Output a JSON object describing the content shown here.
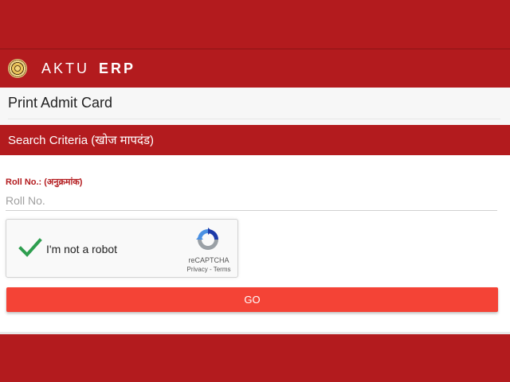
{
  "brand": {
    "part1": "AKTU",
    "part2": "ERP"
  },
  "page": {
    "title": "Print Admit Card"
  },
  "section": {
    "title": "Search Criteria (खोज मापदंड)"
  },
  "form": {
    "roll_label": "Roll No.: (अनुक्रमांक)",
    "roll_placeholder": "Roll No.",
    "roll_value": ""
  },
  "captcha": {
    "checked": true,
    "label": "I'm not a robot",
    "brand": "reCAPTCHA",
    "privacy": "Privacy",
    "separator": " - ",
    "terms": "Terms",
    "icon": "recaptcha-logo-icon"
  },
  "actions": {
    "go_label": "GO"
  },
  "colors": {
    "primary": "#b31b1e",
    "button": "#f44336",
    "label": "#b31b1e"
  }
}
